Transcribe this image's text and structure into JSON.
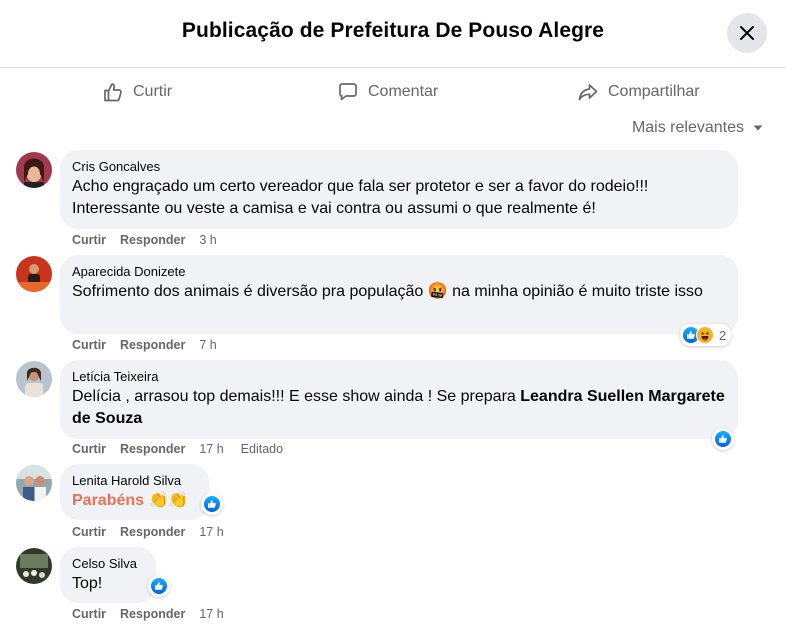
{
  "header": {
    "title": "Publicação de Prefeitura De Pouso Alegre"
  },
  "actions": {
    "like": "Curtir",
    "comment": "Comentar",
    "share": "Compartilhar"
  },
  "sort": {
    "label": "Mais relevantes"
  },
  "comments": [
    {
      "author": "Cris Goncalves",
      "text": "Acho engraçado um certo vereador que fala ser protetor e ser a favor do rodeio!!! Interessante ou veste a camisa e vai contra ou assumi o que realmente é!",
      "like": "Curtir",
      "reply": "Responder",
      "time": "3 h"
    },
    {
      "author": "Aparecida Donizete",
      "text": "Sofrimento dos animais é diversão pra população",
      "emoji": "🤬",
      "text_after": "na minha opinião é muito triste isso",
      "like": "Curtir",
      "reply": "Responder",
      "time": "7 h",
      "reaction_count": "2"
    },
    {
      "author": "Letícia Teixeira",
      "text": "Delícia , arrasou top demais!!! E esse show ainda ! Se prepara",
      "mention": "Leandra Suellen Margarete de Souza",
      "like": "Curtir",
      "reply": "Responder",
      "time": "17 h",
      "edited": "Editado"
    },
    {
      "author": "Lenita Harold Silva",
      "text": "Parabéns",
      "emoji": "👏👏",
      "like": "Curtir",
      "reply": "Responder",
      "time": "17 h"
    },
    {
      "author": "Celso Silva",
      "text": "Top!",
      "like": "Curtir",
      "reply": "Responder",
      "time": "17 h"
    }
  ],
  "colors": {
    "like_blue": "#0866ff",
    "secondary_text": "#65676b",
    "bubble_bg": "#f0f2f5",
    "parabens": "#e8715a"
  }
}
